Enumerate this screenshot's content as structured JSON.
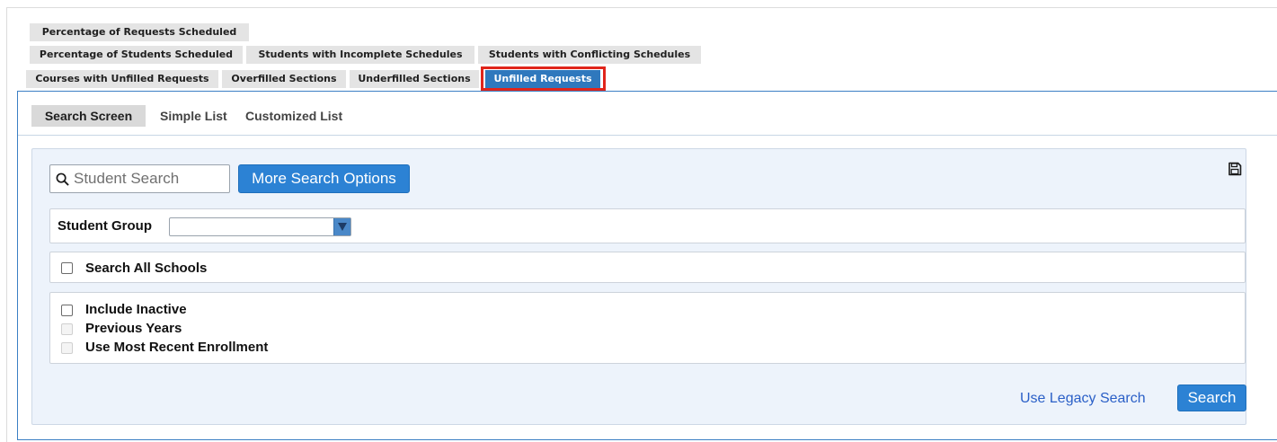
{
  "report_tabs": {
    "row1": [
      "Percentage of Requests Scheduled"
    ],
    "row2": [
      "Percentage of Students Scheduled",
      "Students with Incomplete Schedules",
      "Students with Conflicting Schedules"
    ],
    "row3": [
      "Courses with Unfilled Requests",
      "Overfilled Sections",
      "Underfilled Sections",
      "Unfilled Requests"
    ],
    "active": "Unfilled Requests"
  },
  "subnav": {
    "items": [
      "Search Screen",
      "Simple List",
      "Customized List"
    ],
    "active": "Search Screen"
  },
  "search": {
    "student_search_placeholder": "Student Search",
    "student_search_value": "",
    "more_options_label": "More Search Options",
    "student_group_label": "Student Group",
    "student_group_value": "",
    "search_all_schools_label": "Search All Schools",
    "include_inactive_label": "Include Inactive",
    "previous_years_label": "Previous Years",
    "most_recent_label": "Use Most Recent Enrollment",
    "legacy_search_label": "Use Legacy Search",
    "search_button_label": "Search"
  },
  "colors": {
    "accent": "#2c82d4",
    "active_tab": "#2f78bd",
    "highlight": "#e0251b",
    "panel_bg": "#edf3fb",
    "link": "#2a5fc7"
  },
  "icons": {
    "search": "magnifier-icon",
    "save": "floppy-disk-icon",
    "dropdown": "triangle-down-icon"
  }
}
